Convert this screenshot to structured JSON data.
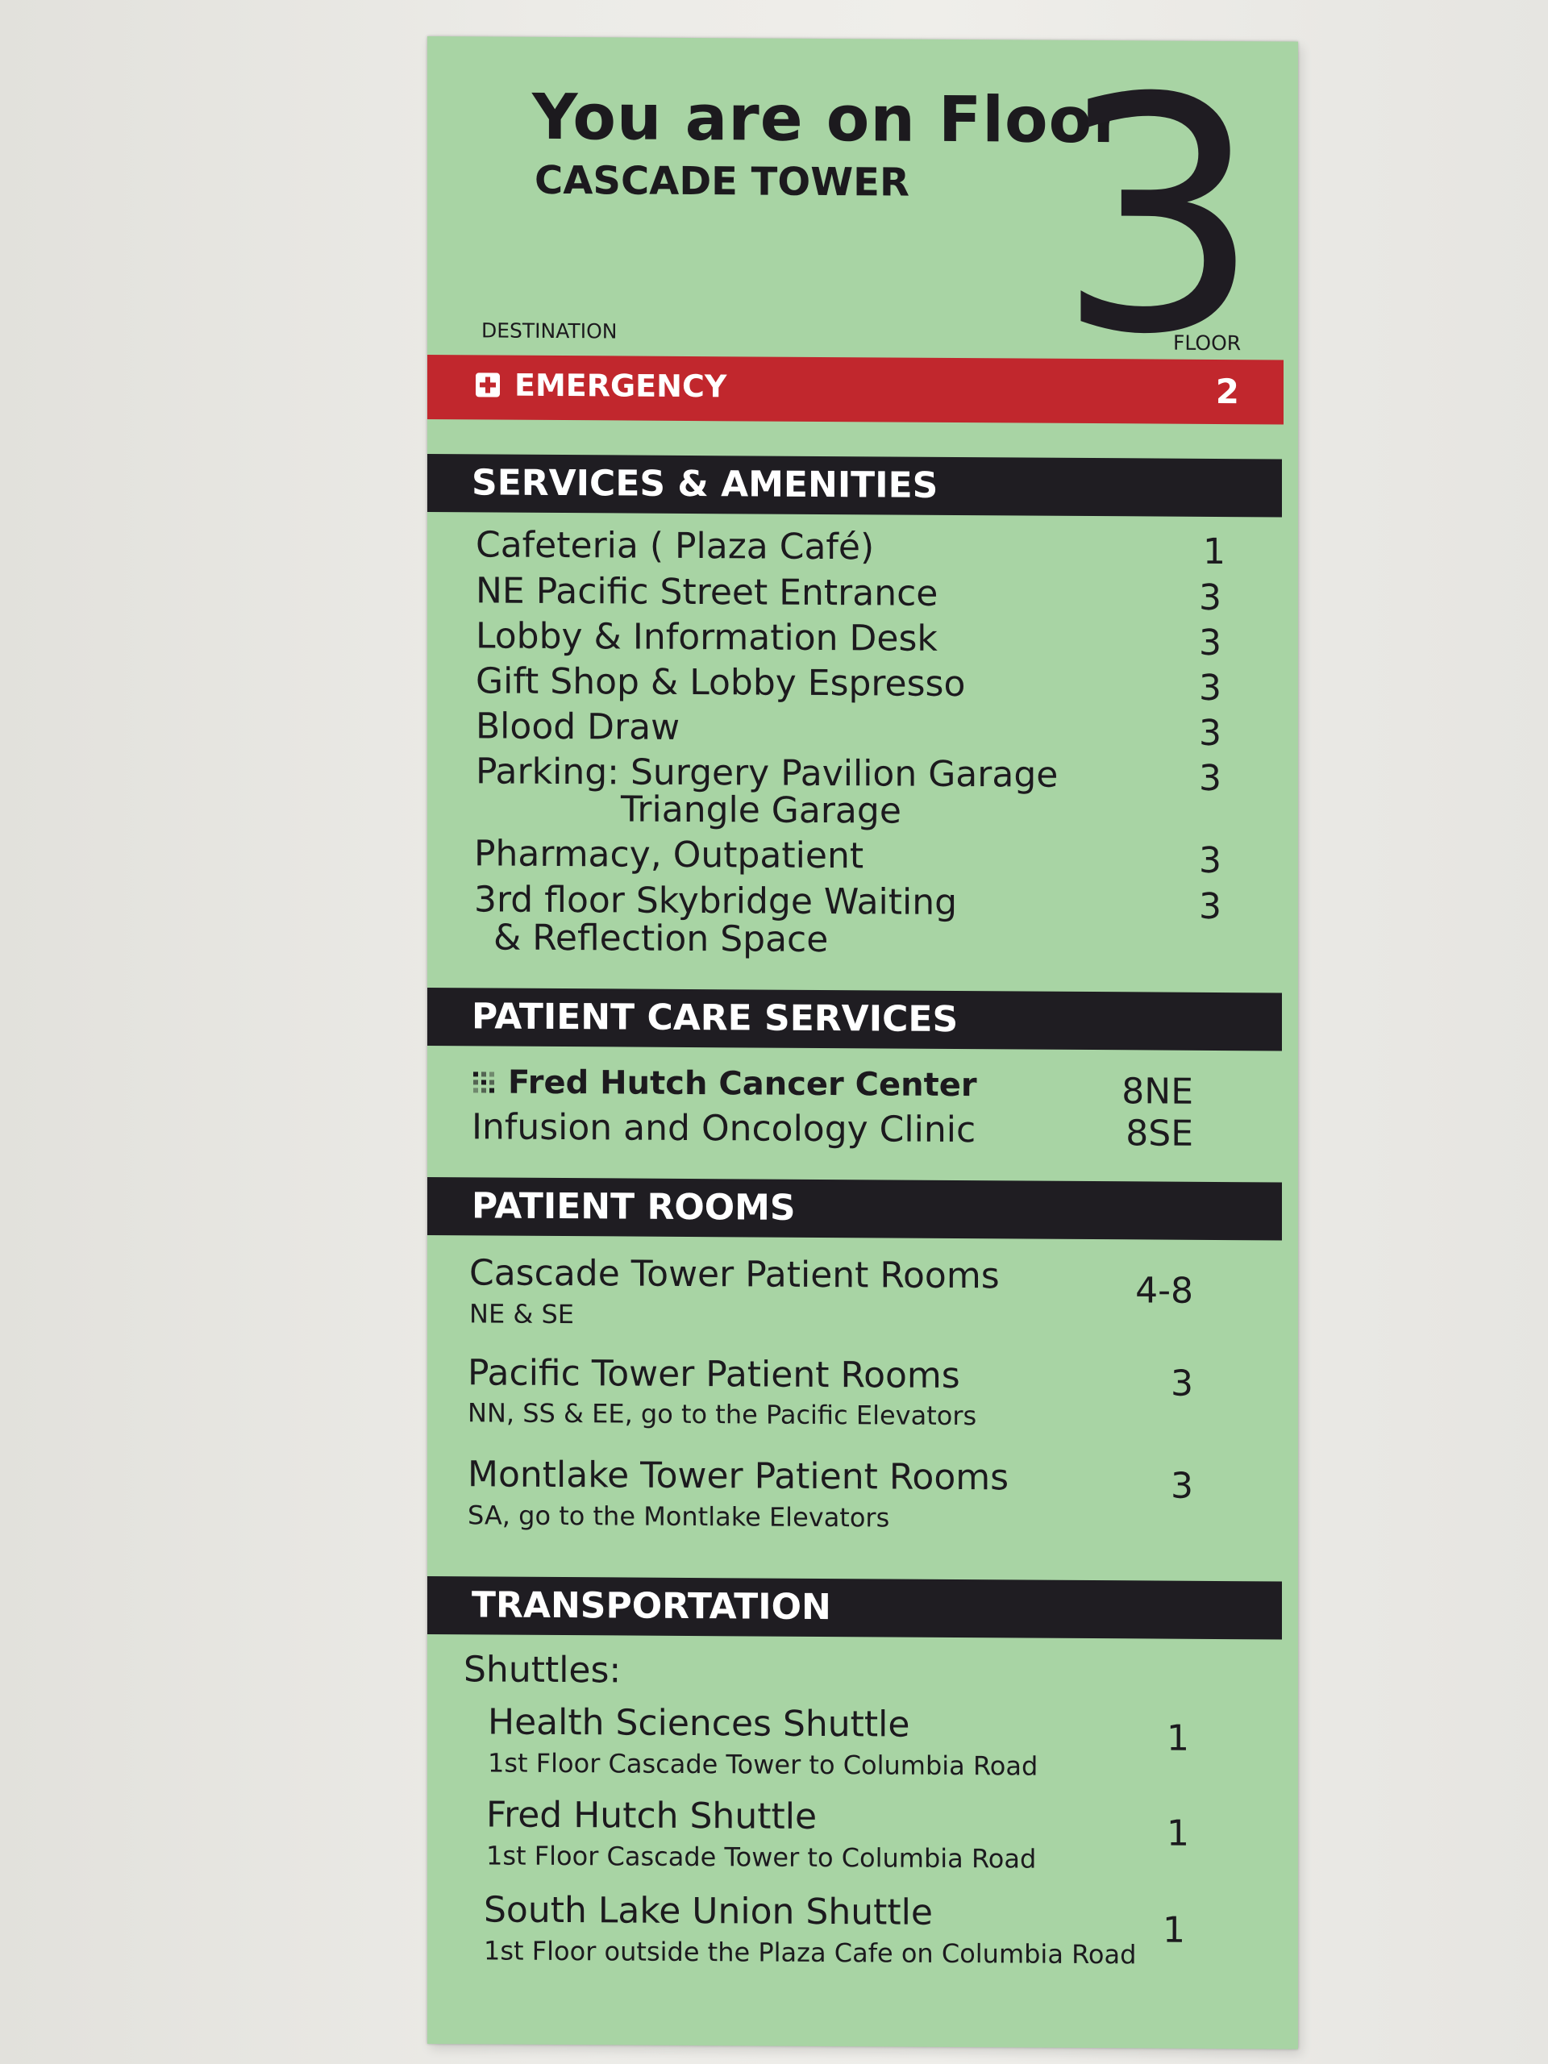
{
  "header": {
    "title": "You are on Floor",
    "building": "CASCADE TOWER",
    "floor_number": "3",
    "destination_label": "DESTINATION",
    "floor_label": "FLOOR"
  },
  "emergency": {
    "label": "EMERGENCY",
    "floor": "2",
    "color": "#c1272d"
  },
  "services": {
    "heading": "SERVICES & AMENITIES",
    "items": [
      {
        "name": "Cafeteria ( Plaza Café)",
        "floor": "1"
      },
      {
        "name": "NE Pacific Street Entrance",
        "floor": "3"
      },
      {
        "name": "Lobby & Information Desk",
        "floor": "3"
      },
      {
        "name": "Gift Shop & Lobby Espresso",
        "floor": "3"
      },
      {
        "name": "Blood Draw",
        "floor": "3"
      },
      {
        "name": "Parking: Surgery Pavilion Garage",
        "name2": "Triangle Garage",
        "floor": "3"
      },
      {
        "name": "Pharmacy, Outpatient",
        "floor": "3"
      },
      {
        "name": "3rd floor Skybridge Waiting",
        "name2": "& Reflection Space",
        "floor": "3"
      }
    ]
  },
  "patient_care": {
    "heading": "PATIENT CARE SERVICES",
    "items": [
      {
        "name": "Fred Hutch Cancer Center",
        "floor": "8NE",
        "icon": "fred-hutch-logo-icon"
      },
      {
        "name": "Infusion and Oncology Clinic",
        "floor": "8SE"
      }
    ]
  },
  "patient_rooms": {
    "heading": "PATIENT ROOMS",
    "items": [
      {
        "name": "Cascade Tower Patient Rooms",
        "note": "NE & SE",
        "floor": "4-8"
      },
      {
        "name": "Pacific Tower Patient Rooms",
        "note": "NN, SS & EE, go to the Pacific Elevators",
        "floor": "3"
      },
      {
        "name": "Montlake Tower Patient Rooms",
        "note": "SA, go to the Montlake Elevators",
        "floor": "3"
      }
    ]
  },
  "transportation": {
    "heading": "TRANSPORTATION",
    "subheading": "Shuttles:",
    "items": [
      {
        "name": "Health Sciences Shuttle",
        "note": "1st Floor Cascade Tower to Columbia Road",
        "floor": "1"
      },
      {
        "name": "Fred Hutch Shuttle",
        "note": "1st Floor Cascade Tower to Columbia Road",
        "floor": "1"
      },
      {
        "name": "South Lake Union Shuttle",
        "note": "1st Floor outside the Plaza Cafe on Columbia Road",
        "floor": "1"
      }
    ]
  },
  "colors": {
    "sign_background": "#a8d4a4",
    "header_bar": "#1f1d22",
    "text": "#1c1a1e"
  }
}
